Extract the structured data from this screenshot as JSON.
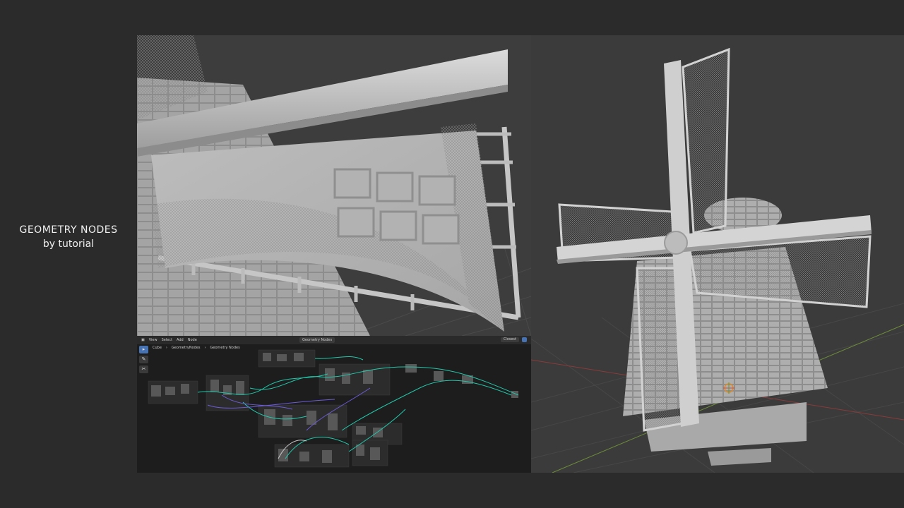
{
  "caption": {
    "line1": "GEOMETRY NODES",
    "line2": "by tutorial"
  },
  "node_editor": {
    "menu": [
      "View",
      "Select",
      "Add",
      "Node"
    ],
    "center_field": "Geometry Nodes",
    "breadcrumb": [
      "Cube",
      "GeometryNodes",
      "Geometry Nodes"
    ],
    "snapping": "Closest"
  },
  "colors": {
    "background": "#2b2b2b",
    "viewport": "#3b3b3b",
    "node_editor": "#1d1d1d",
    "accent": "#4772b3"
  }
}
